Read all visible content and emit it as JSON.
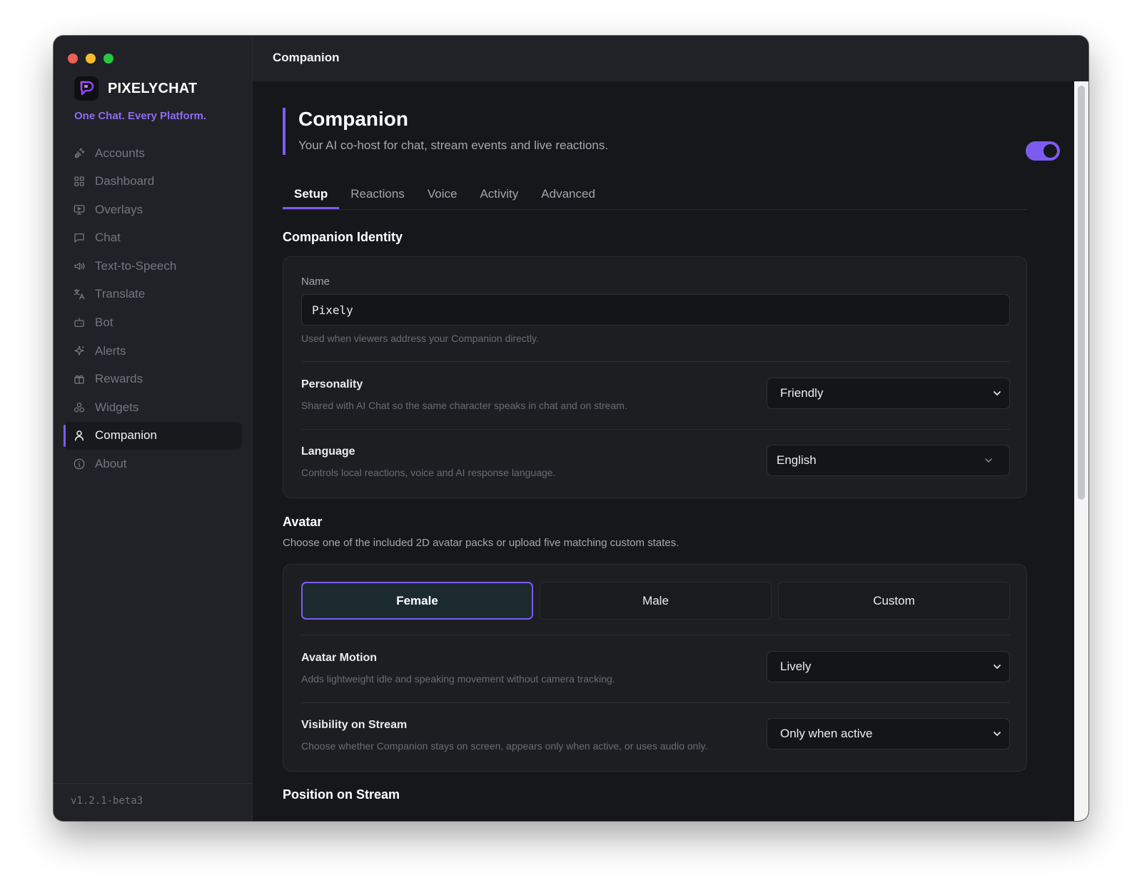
{
  "window": {
    "title": "Companion"
  },
  "brand": {
    "name": "PIXELYCHAT",
    "tagline": "One Chat. Every Platform."
  },
  "sidebar": {
    "items": [
      {
        "label": "Accounts",
        "icon": "plug-icon"
      },
      {
        "label": "Dashboard",
        "icon": "grid-icon"
      },
      {
        "label": "Overlays",
        "icon": "monitor-icon"
      },
      {
        "label": "Chat",
        "icon": "chat-icon"
      },
      {
        "label": "Text-to-Speech",
        "icon": "speaker-icon"
      },
      {
        "label": "Translate",
        "icon": "translate-icon"
      },
      {
        "label": "Bot",
        "icon": "bot-icon"
      },
      {
        "label": "Alerts",
        "icon": "sparkle-icon"
      },
      {
        "label": "Rewards",
        "icon": "gift-icon"
      },
      {
        "label": "Widgets",
        "icon": "widgets-icon"
      },
      {
        "label": "Companion",
        "icon": "user-icon",
        "active": true
      },
      {
        "label": "About",
        "icon": "info-icon"
      }
    ],
    "version": "v1.2.1-beta3"
  },
  "header": {
    "title": "Companion",
    "subtitle": "Your AI co-host for chat, stream events and live reactions.",
    "enabled": true
  },
  "tabs": [
    {
      "label": "Setup",
      "active": true
    },
    {
      "label": "Reactions"
    },
    {
      "label": "Voice"
    },
    {
      "label": "Activity"
    },
    {
      "label": "Advanced"
    }
  ],
  "identity": {
    "title": "Companion Identity",
    "name_label": "Name",
    "name_value": "Pixely",
    "name_help": "Used when viewers address your Companion directly.",
    "personality_label": "Personality",
    "personality_desc": "Shared with AI Chat so the same character speaks in chat and on stream.",
    "personality_value": "Friendly",
    "language_label": "Language",
    "language_desc": "Controls local reactions, voice and AI response language.",
    "language_value": "English"
  },
  "avatar": {
    "title": "Avatar",
    "desc": "Choose one of the included 2D avatar packs or upload five matching custom states.",
    "options": [
      "Female",
      "Male",
      "Custom"
    ],
    "selected": "Female",
    "motion_label": "Avatar Motion",
    "motion_desc": "Adds lightweight idle and speaking movement without camera tracking.",
    "motion_value": "Lively",
    "visibility_label": "Visibility on Stream",
    "visibility_desc": "Choose whether Companion stays on screen, appears only when active, or uses audio only.",
    "visibility_value": "Only when active"
  },
  "position": {
    "title": "Position on Stream"
  },
  "colors": {
    "accent": "#7c5cf0",
    "background": "#16171a",
    "sidebar": "#212227"
  }
}
